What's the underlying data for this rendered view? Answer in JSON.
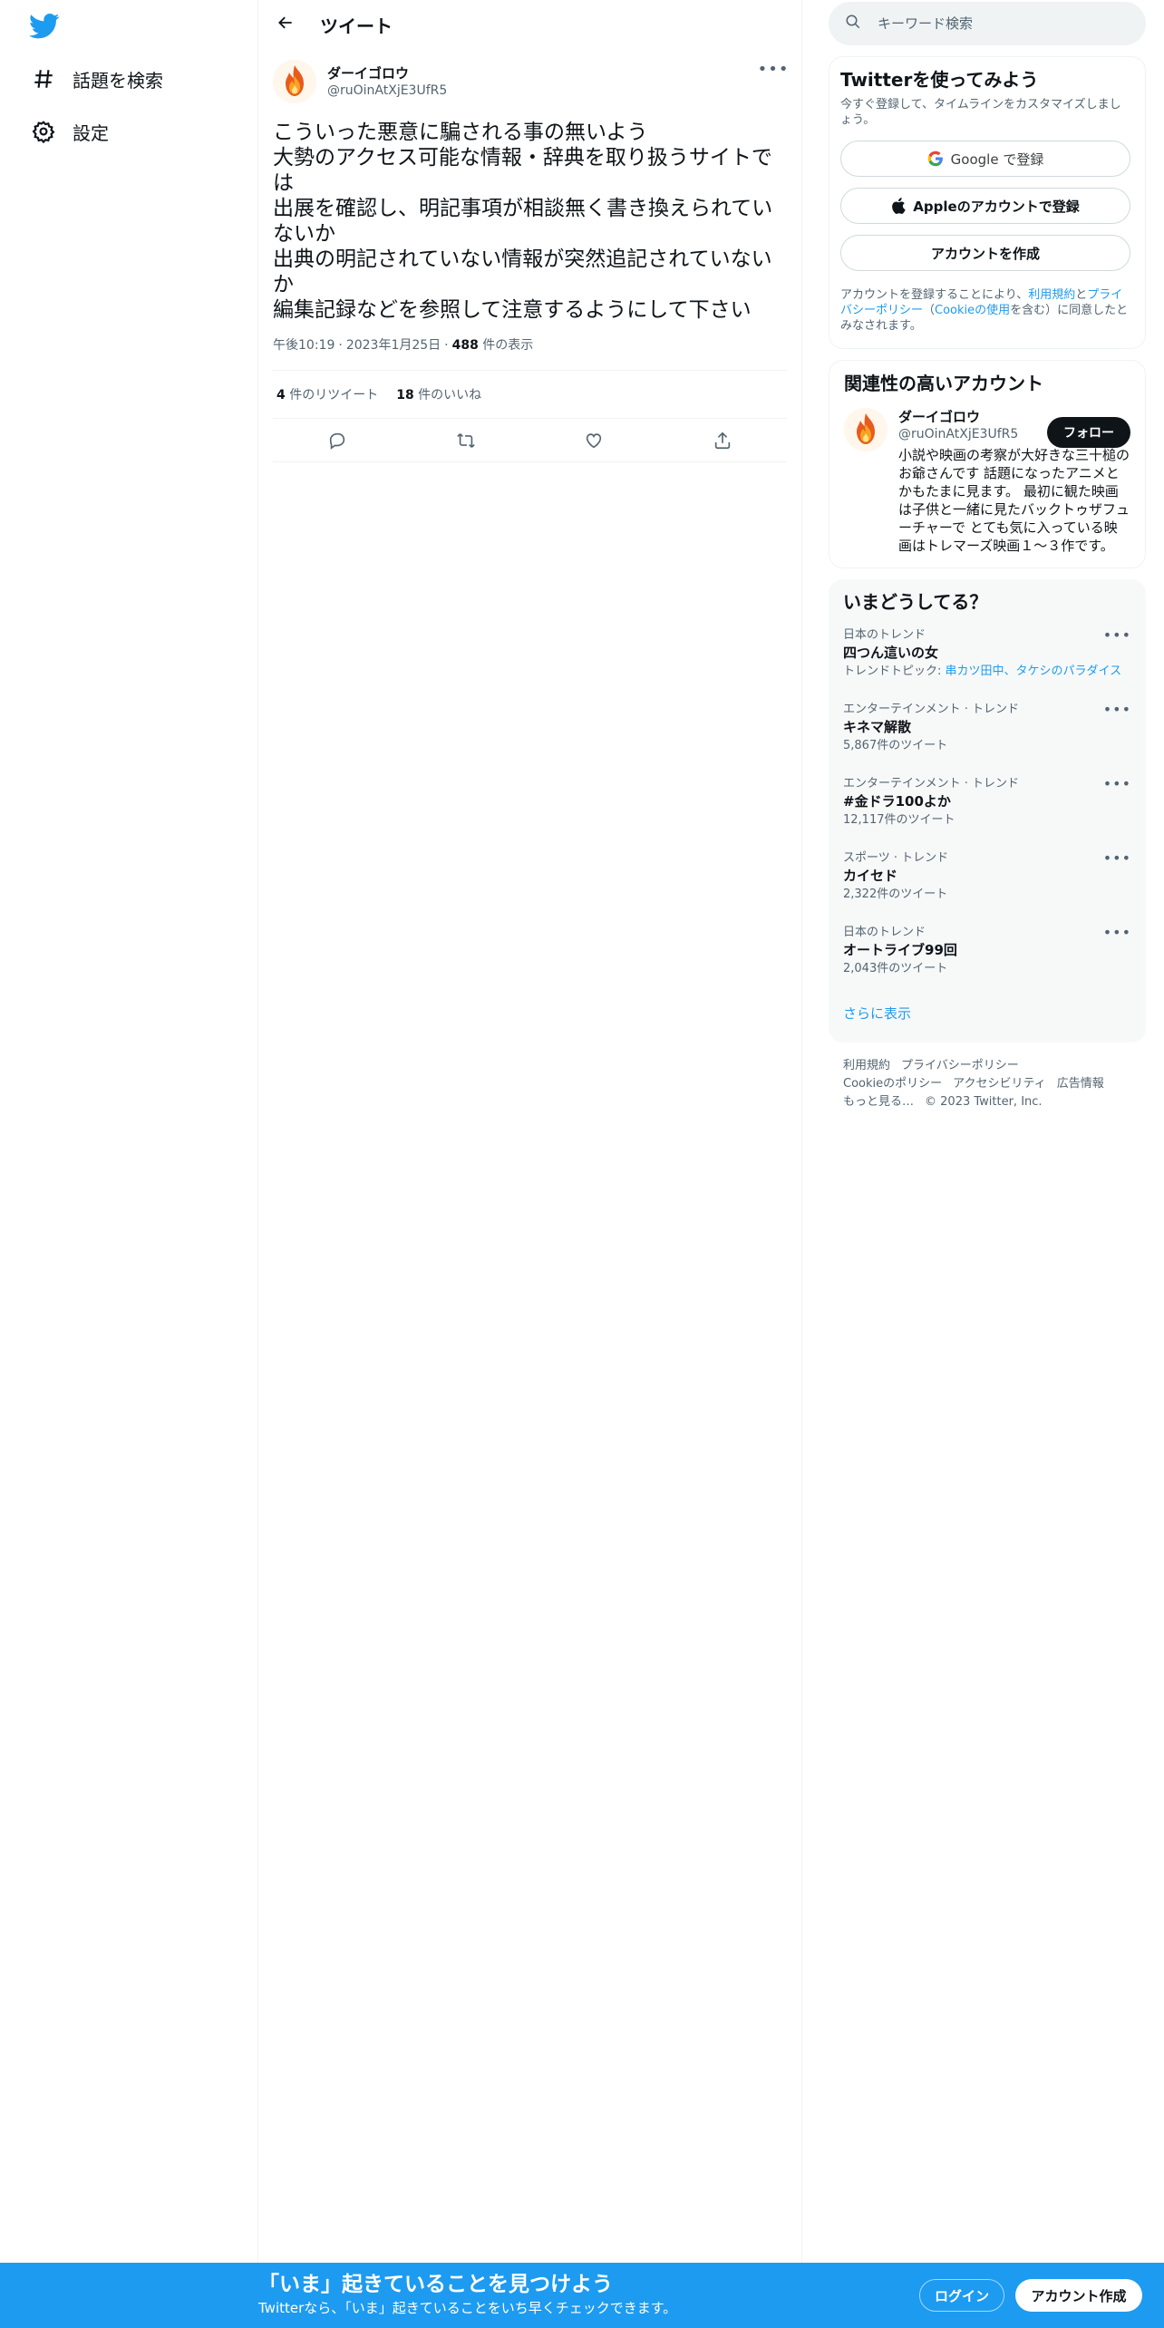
{
  "left_nav": {
    "items": [
      {
        "label": "話題を検索",
        "icon": "hashtag-icon"
      },
      {
        "label": "設定",
        "icon": "gear-icon"
      }
    ]
  },
  "main": {
    "title": "ツイート",
    "tweet": {
      "display_name": "ダーイゴロウ",
      "handle": "@ruOinAtXjE3UfR5",
      "text": "こういった悪意に騙される事の無いよう\n大勢のアクセス可能な情報・辞典を取り扱うサイトでは\n出展を確認し、明記事項が相談無く書き換えられていないか\n出典の明記されていない情報が突然追記されていないか\n編集記録などを参照して注意するようにして下さい",
      "time": "午後10:19",
      "date": "2023年1月25日",
      "views_count": "488",
      "views_label": " 件の表示",
      "retweets_count": "4",
      "retweets_label": " 件のリツイート",
      "likes_count": "18",
      "likes_label": " 件のいいね"
    }
  },
  "right": {
    "search": {
      "placeholder": "キーワード検索"
    },
    "signup": {
      "title": "Twitterを使ってみよう",
      "subtitle": "今すぐ登録して、タイムラインをカスタマイズしましょう。",
      "google_label": "Google で登録",
      "apple_label": "Appleのアカウントで登録",
      "create_label": "アカウントを作成",
      "legal_pre": "アカウントを登録することにより、",
      "legal_terms": "利用規約",
      "legal_and": "と",
      "legal_privacy": "プライバシーポリシー",
      "legal_open": "（",
      "legal_cookie": "Cookieの使用",
      "legal_post": "を含む）に同意したとみなされます。"
    },
    "related": {
      "title": "関連性の高いアカウント",
      "name": "ダーイゴロウ",
      "handle": "@ruOinAtXjE3UfR5",
      "follow_label": "フォロー",
      "bio": "小説や映画の考察が大好きな三十槌のお爺さんです 話題になったアニメとかもたまに見ます。 最初に観た映画は子供と一緒に見たバックトゥザフューチャーで とても気に入っている映画はトレマーズ映画１～３作です。"
    },
    "trends": {
      "title": "いまどうしてる？",
      "items": [
        {
          "context": "日本のトレンド",
          "name": "四つん這いの女",
          "count_prefix": "トレンドトピック: ",
          "count": "串カツ田中、タケシのパラダイス"
        },
        {
          "context": "エンターテインメント · トレンド",
          "name": "キネマ解散",
          "count_prefix": "",
          "count": "5,867件のツイート"
        },
        {
          "context": "エンターテインメント · トレンド",
          "name": "#金ドラ100よか",
          "count_prefix": "",
          "count": "12,117件のツイート"
        },
        {
          "context": "スポーツ · トレンド",
          "name": "カイセド",
          "count_prefix": "",
          "count": "2,322件のツイート"
        },
        {
          "context": "日本のトレンド",
          "name": "オートライブ99回",
          "count_prefix": "",
          "count": "2,043件のツイート"
        }
      ],
      "show_more": "さらに表示"
    },
    "footer": {
      "terms": "利用規約",
      "privacy": "プライバシーポリシー",
      "cookie": "Cookieのポリシー",
      "accessibility": "アクセシビリティ",
      "ads": "広告情報",
      "more": "もっと見る…",
      "copyright": "© 2023 Twitter, Inc."
    }
  },
  "bottom_bar": {
    "title": "「いま」起きていることを見つけよう",
    "subtitle": "Twitterなら、「いま」起きていることをいち早くチェックできます。",
    "login_label": "ログイン",
    "signup_label": "アカウント作成"
  },
  "colors": {
    "brand": "#1d9bf0",
    "text": "#0f1419",
    "muted": "#536471",
    "border": "#eff3f4"
  }
}
